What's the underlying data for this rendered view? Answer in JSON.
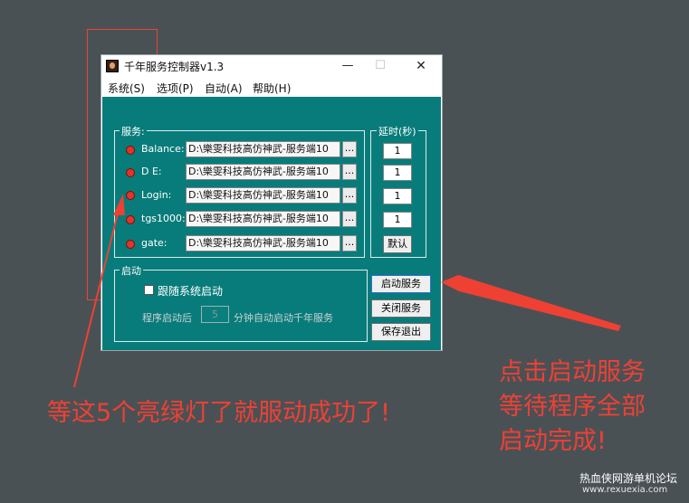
{
  "window": {
    "title": "千年服务控制器v1.3",
    "minimize_glyph": "—",
    "maximize_glyph": "☐",
    "close_glyph": "✕"
  },
  "menu": [
    "系统(S)",
    "选项(P)",
    "自动(A)",
    "帮助(H)"
  ],
  "services_group": {
    "label": "服务:",
    "items": [
      {
        "name": "Balance:",
        "path": "D:\\樂雯科技高仿神武-服务端10",
        "status_color": "#e1342b"
      },
      {
        "name": "D E:",
        "path": "D:\\樂雯科技高仿神武-服务端10",
        "status_color": "#e1342b"
      },
      {
        "name": "Login:",
        "path": "D:\\樂雯科技高仿神武-服务端10",
        "status_color": "#e1342b"
      },
      {
        "name": "tgs1000:",
        "path": "D:\\樂雯科技高仿神武-服务端10",
        "status_color": "#e1342b"
      },
      {
        "name": "gate:",
        "path": "D:\\樂雯科技高仿神武-服务端10",
        "status_color": "#e1342b"
      }
    ],
    "browse_label": "..."
  },
  "delay_group": {
    "label": "延时(秒)",
    "values": [
      "1",
      "1",
      "1",
      "1"
    ],
    "default_label": "默认"
  },
  "startup_group": {
    "label": "启动",
    "checkbox_label": "跟随系统启动",
    "delay_prefix": "程序启动后",
    "delay_value": "5",
    "delay_suffix": "分钟自动启动千年服务"
  },
  "buttons": {
    "start": "启动服务",
    "stop": "关闭服务",
    "save_exit": "保存退出"
  },
  "annotations": {
    "left_note": "等这5个亮绿灯了就服动成功了!",
    "right_note_lines": [
      "点击启动服务",
      "等待程序全部",
      "启动完成!"
    ],
    "accent_color": "#ef4034"
  },
  "watermark": {
    "site_name": "热血侠网游单机论坛",
    "site_url": "www.rexuexia.com"
  }
}
